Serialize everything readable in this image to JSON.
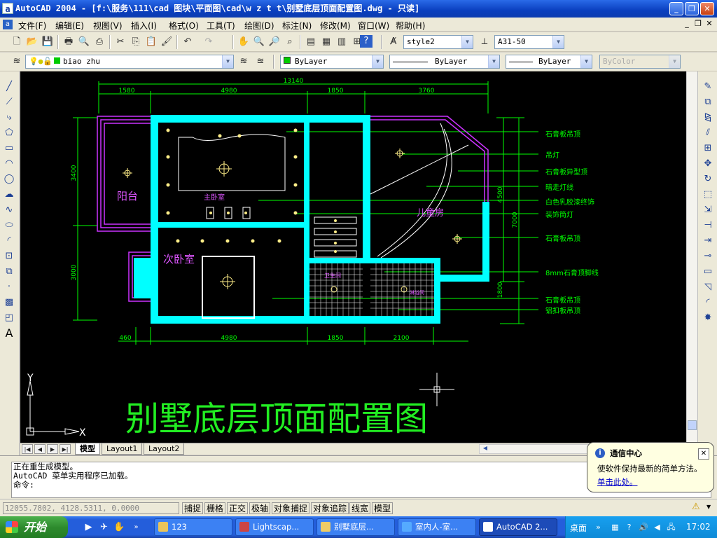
{
  "window": {
    "title": "AutoCAD 2004 - [f:\\服务\\111\\cad 图块\\平面图\\cad\\w z t t\\别墅底层顶面配置图.dwg - 只读]",
    "app_icon": "a"
  },
  "menu": [
    "文件(F)",
    "编辑(E)",
    "视图(V)",
    "插入(I)",
    "格式(O)",
    "工具(T)",
    "绘图(D)",
    "标注(N)",
    "修改(M)",
    "窗口(W)",
    "帮助(H)"
  ],
  "toolbar": {
    "text_style": "style2",
    "dim_style": "A31-50",
    "layer": "biao zhu",
    "color": "ByLayer",
    "linetype": "ByLayer",
    "lineweight": "ByLayer",
    "plot_style": "ByColor"
  },
  "drawing": {
    "title": "别墅底层顶面配置图",
    "top_dims": {
      "total": "13140",
      "segments": [
        "1580",
        "4980",
        "1850",
        "3760"
      ]
    },
    "bottom_dims": [
      "460",
      "4980",
      "1850",
      "2100"
    ],
    "left_dims": [
      "3400",
      "3000"
    ],
    "right_dims": [
      "4500",
      "7000",
      "1800"
    ],
    "rooms": {
      "balcony": "阳台",
      "master_bedroom": "主卧室",
      "second_bedroom": "次卧室",
      "kids_room": "儿童房",
      "bathroom1": "卫生间",
      "bathroom2": "淋浴间"
    },
    "legend": [
      "石膏板吊顶",
      "吊灯",
      "石膏板异型顶",
      "暗走灯线",
      "白色乳胶漆终饰",
      "装饰筒灯",
      "石膏板吊顶",
      "8mm石膏顶脚线",
      "石膏板吊顶",
      "铝扣板吊顶"
    ],
    "ucs": {
      "x": "X",
      "y": "Y"
    },
    "colors": {
      "walls": "#00ffff",
      "dims": "#00ff00",
      "text": "#ff44ff",
      "lamps": "#ffee88",
      "title": "#22ee22"
    }
  },
  "tabs": [
    "模型",
    "Layout1",
    "Layout2"
  ],
  "command": {
    "lines": [
      "正在重生成模型。",
      "AutoCAD 菜单实用程序已加载。"
    ],
    "prompt": "命令:"
  },
  "status": {
    "coords": "12055.7802, 4128.5311, 0.0000",
    "buttons": [
      "捕捉",
      "栅格",
      "正交",
      "极轴",
      "对象捕捉",
      "对象追踪",
      "线宽",
      "模型"
    ]
  },
  "balloon": {
    "title": "通信中心",
    "body": "使软件保持最新的简单方法。",
    "link": "单击此处。"
  },
  "taskbar": {
    "start": "开始",
    "tasks": [
      "123",
      "Lightscap...",
      "别墅底层...",
      "室内人-室...",
      "AutoCAD 2..."
    ],
    "desktop": "桌面",
    "clock": "17:02"
  }
}
